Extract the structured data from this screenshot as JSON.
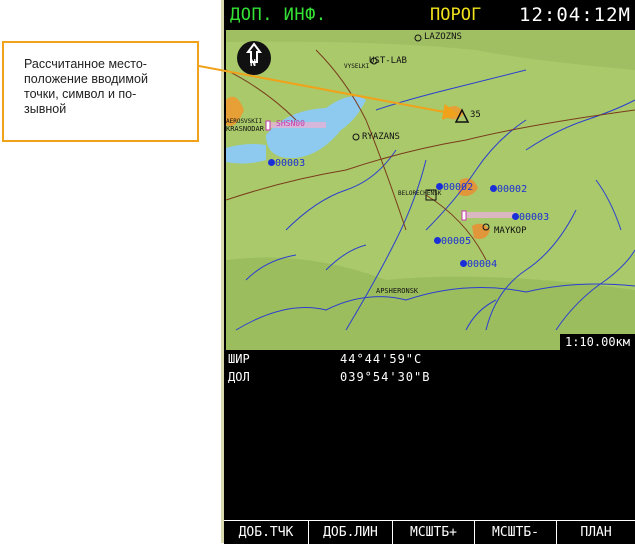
{
  "callout": {
    "lines": [
      "Рассчитанное место-",
      "положение вводимой",
      "точки, символ и по-",
      "зывной"
    ]
  },
  "topbar": {
    "left": "ДОП. ИНФ.",
    "mode": "ПОРОГ",
    "time": "12:04:12М"
  },
  "map": {
    "north_label": "N",
    "scale": "1:10.00км",
    "cities": [
      {
        "name": "LAZOZNS"
      },
      {
        "name": "UST-LAB"
      },
      {
        "name": "RYAZANS"
      },
      {
        "name": "BELORECHENSK"
      },
      {
        "name": "MAYKOP"
      },
      {
        "name": "APSHERONSK"
      },
      {
        "name": "KRASNODAR"
      },
      {
        "name": "VYSELKI"
      },
      {
        "name": "AEROSVSKII"
      }
    ],
    "waypoints": [
      {
        "label": "00003"
      },
      {
        "label": "00002"
      },
      {
        "label": "00002"
      },
      {
        "label": "00003"
      },
      {
        "label": "00005"
      },
      {
        "label": "00004"
      }
    ],
    "computed_point": {
      "label": "35"
    },
    "route_label": "SHSN00"
  },
  "coords": {
    "lat_label": "ШИР",
    "lat_value": "44°44'59\"С",
    "lon_label": "ДОЛ",
    "lon_value": "039°54'30\"В"
  },
  "softkeys": [
    "ДОБ.ТЧК",
    "ДОБ.ЛИН",
    "МСШТБ+",
    "МСШТБ-",
    "ПЛАН"
  ],
  "colors": {
    "accent": "#f0a21b",
    "waypoint": "#1b2fd8",
    "terrain": "#a9c96a",
    "water": "#8ecaf0"
  }
}
